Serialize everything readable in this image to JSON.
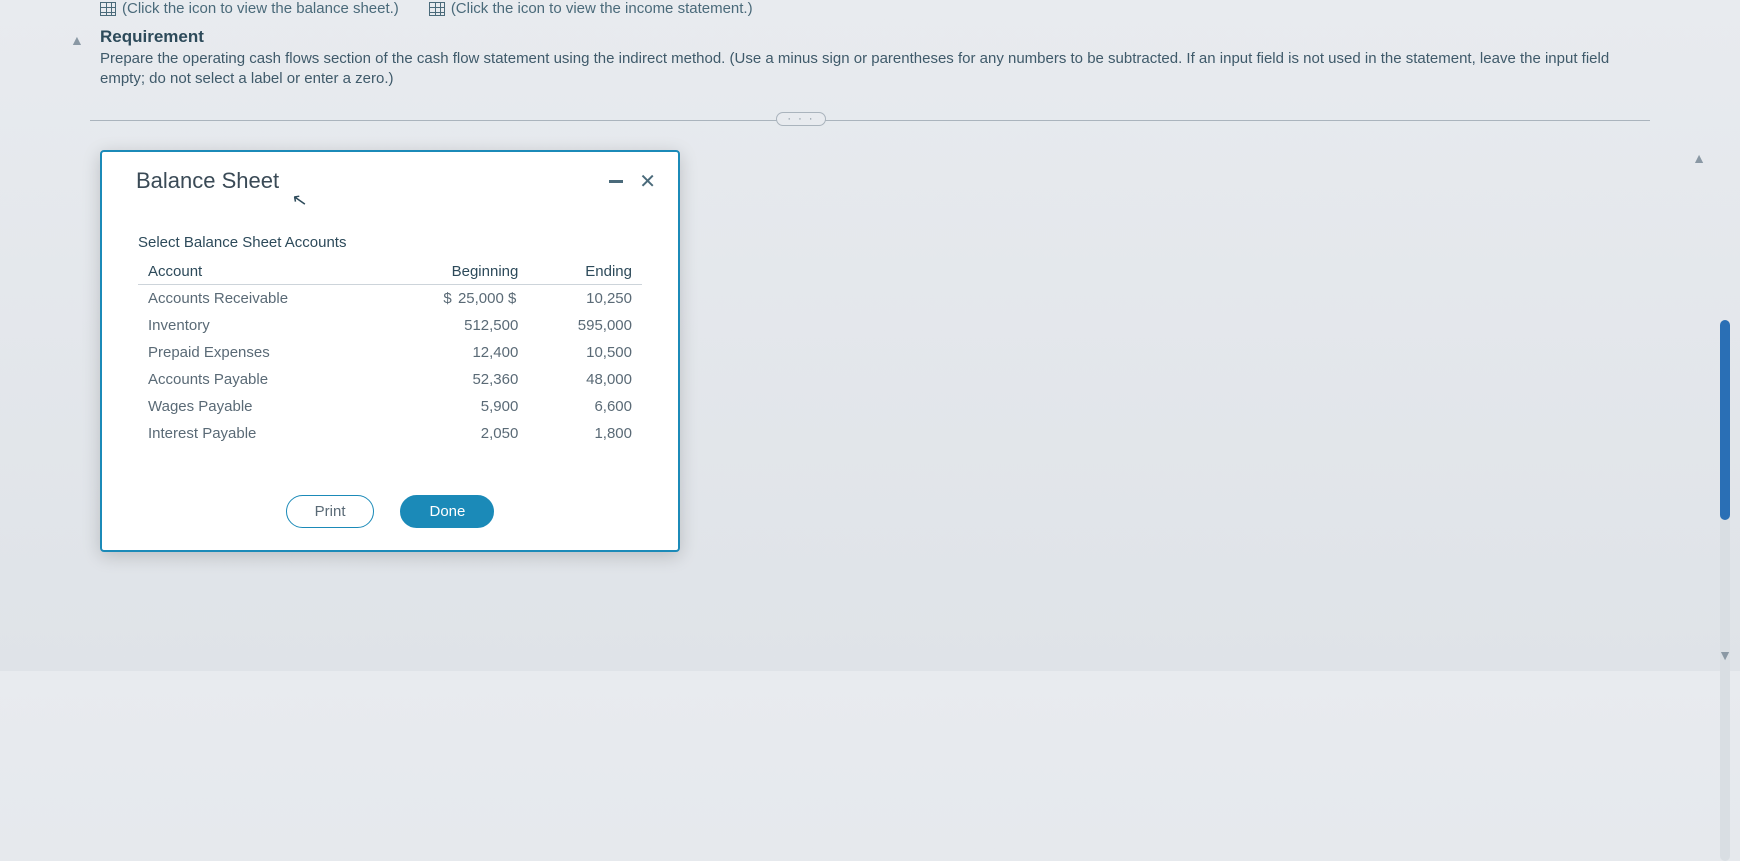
{
  "links": {
    "balance_sheet": "(Click the icon to view the balance sheet.)",
    "income_statement": "(Click the icon to view the income statement.)"
  },
  "requirement": {
    "title": "Requirement",
    "text": "Prepare the operating cash flows section of the cash flow statement using the indirect method. (Use a minus sign or parentheses for any numbers to be subtracted. If an input field is not used in the statement, leave the input field empty; do not select a label or enter a zero.)"
  },
  "divider_label": "· · ·",
  "dialog": {
    "title": "Balance Sheet",
    "subtitle": "Select Balance Sheet Accounts",
    "columns": {
      "c0": "Account",
      "c1": "Beginning",
      "c2": "Ending"
    },
    "currency": "$",
    "rows": [
      {
        "acct": "Accounts Receivable",
        "beg": "25,000",
        "end": "10,250"
      },
      {
        "acct": "Inventory",
        "beg": "512,500",
        "end": "595,000"
      },
      {
        "acct": "Prepaid Expenses",
        "beg": "12,400",
        "end": "10,500"
      },
      {
        "acct": "Accounts Payable",
        "beg": "52,360",
        "end": "48,000"
      },
      {
        "acct": "Wages Payable",
        "beg": "5,900",
        "end": "6,600"
      },
      {
        "acct": "Interest Payable",
        "beg": "2,050",
        "end": "1,800"
      }
    ],
    "buttons": {
      "print": "Print",
      "done": "Done"
    }
  }
}
